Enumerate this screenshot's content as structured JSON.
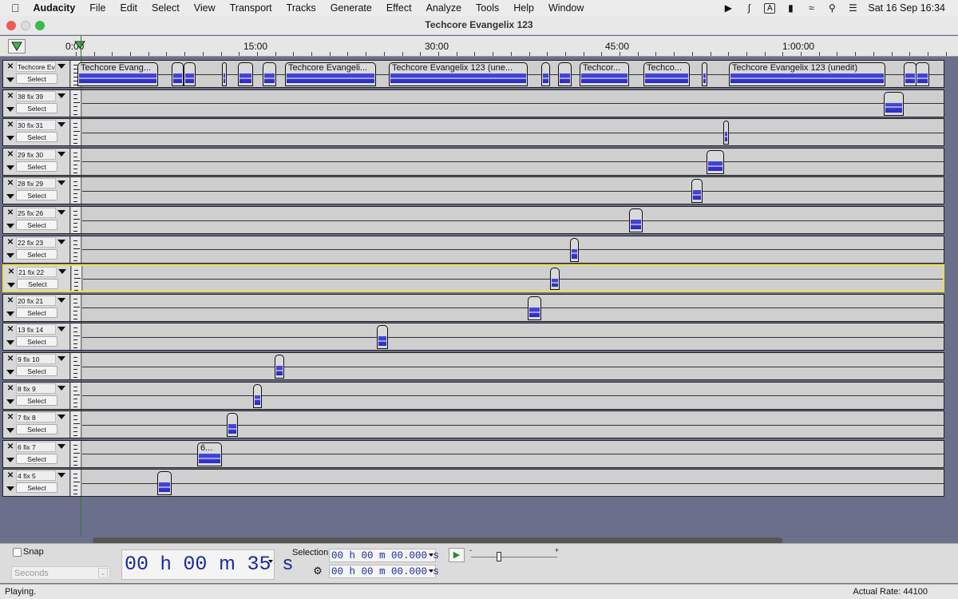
{
  "menubar": {
    "items": [
      "Audacity",
      "File",
      "Edit",
      "Select",
      "View",
      "Transport",
      "Tracks",
      "Generate",
      "Effect",
      "Analyze",
      "Tools",
      "Help",
      "Window"
    ],
    "keyboard_indicator": "A",
    "datetime": "Sat 16 Sep  16:34"
  },
  "window": {
    "title": "Techcore Evangelix 123"
  },
  "ruler": {
    "labels": [
      "0:00",
      "15:00",
      "30:00",
      "45:00",
      "1:00:00"
    ]
  },
  "tracks": [
    {
      "name": "Techcore Eva",
      "select_label": "Select",
      "clips": [
        "Techcore Evang...",
        "",
        "",
        "",
        "",
        "",
        "Techcore Evangeli...",
        "Techcore Evangelix 123 (une...",
        "",
        "",
        "Techcor...",
        "Techco...",
        "",
        "Techcore Evangelix 123 (unedit)",
        "",
        ""
      ]
    },
    {
      "name": "38 fix 39",
      "select_label": "Select",
      "clips": [
        ""
      ]
    },
    {
      "name": "30 fix 31",
      "select_label": "Select",
      "clips": [
        ""
      ]
    },
    {
      "name": "29 fix 30",
      "select_label": "Select",
      "clips": [
        ""
      ]
    },
    {
      "name": "28 fix 29",
      "select_label": "Select",
      "clips": [
        ""
      ]
    },
    {
      "name": "25 fix 26",
      "select_label": "Select",
      "clips": [
        ""
      ]
    },
    {
      "name": "22 fix 23",
      "select_label": "Select",
      "clips": [
        ""
      ]
    },
    {
      "name": "21 fix 22",
      "select_label": "Select",
      "clips": [
        ""
      ]
    },
    {
      "name": "20 fix 21",
      "select_label": "Select",
      "clips": [
        ""
      ]
    },
    {
      "name": "13 fix 14",
      "select_label": "Select",
      "clips": [
        ""
      ]
    },
    {
      "name": "9 fix 10",
      "select_label": "Select",
      "clips": [
        ""
      ]
    },
    {
      "name": "8 fix 9",
      "select_label": "Select",
      "clips": [
        ""
      ]
    },
    {
      "name": "7 fix 8",
      "select_label": "Select",
      "clips": [
        ""
      ]
    },
    {
      "name": "6 fix 7",
      "select_label": "Select",
      "clips": [
        "6..."
      ]
    },
    {
      "name": "4 fix 5",
      "select_label": "Select",
      "clips": [
        ""
      ]
    }
  ],
  "bottom": {
    "snap_label": "Snap",
    "snap_unit": "Seconds",
    "time": {
      "hours": "00",
      "h": "h",
      "minutes": "00",
      "m": "m",
      "seconds": "35",
      "s": "s"
    },
    "selection_label": "Selection",
    "sel_start": "00 h 00 m 00.000 s",
    "sel_end": "00 h 00 m 00.000 s",
    "speed_min": "-",
    "speed_max": "+"
  },
  "status": {
    "left": "Playing.",
    "right": "Actual Rate: 44100"
  },
  "colors": {
    "waveform": "#3434cc",
    "playhead": "#2a7a2a",
    "active_track_border": "#e6e04a"
  }
}
